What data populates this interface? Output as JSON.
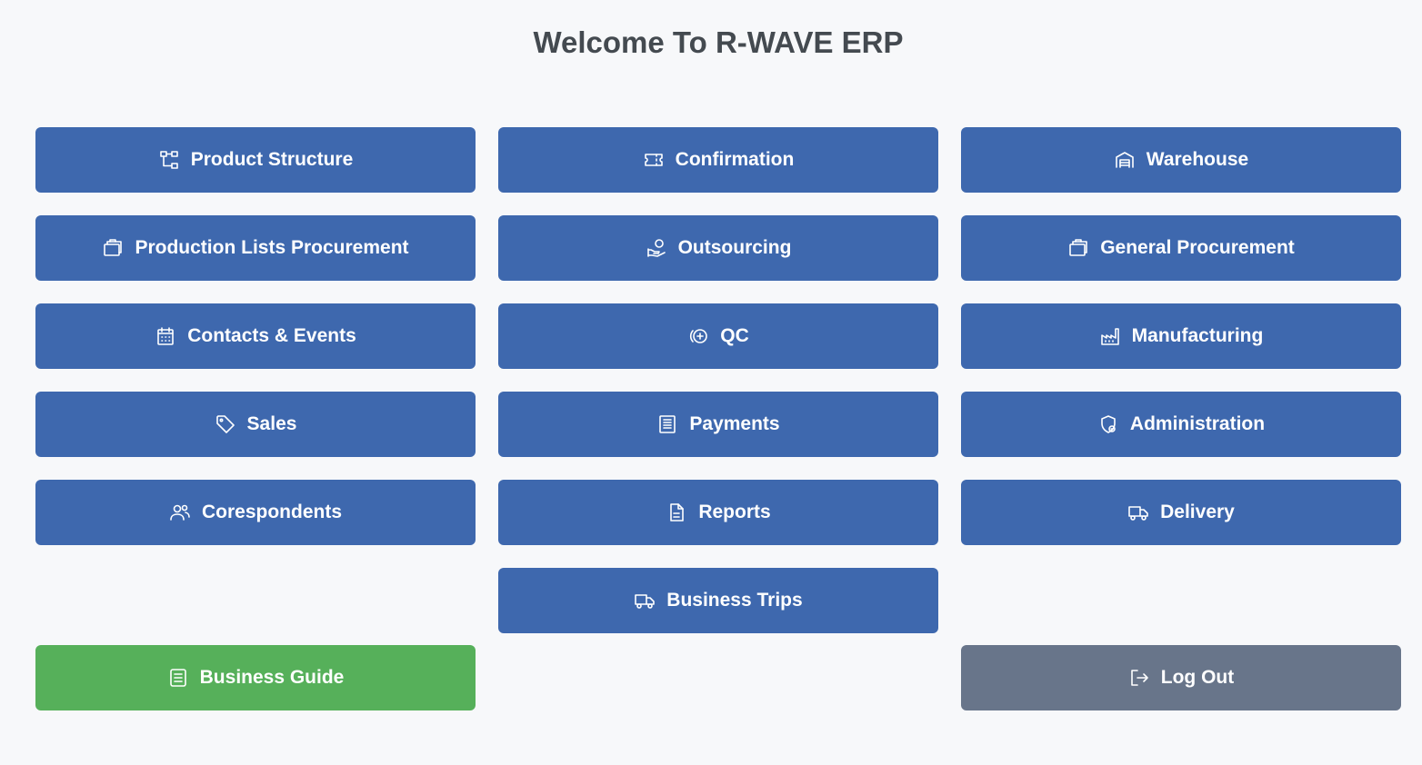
{
  "header": {
    "title": "Welcome To R-WAVE ERP"
  },
  "colors": {
    "primary_button": "#3e68ae",
    "guide_button": "#56b05a",
    "logout_button": "#68758a",
    "background": "#f7f8fa"
  },
  "menu": {
    "product_structure": {
      "label": "Product Structure",
      "icon": "hierarchy-icon"
    },
    "confirmation": {
      "label": "Confirmation",
      "icon": "ticket-icon"
    },
    "warehouse": {
      "label": "Warehouse",
      "icon": "warehouse-icon"
    },
    "production_lists_procurement": {
      "label": "Production Lists Procurement",
      "icon": "stack-icon"
    },
    "outsourcing": {
      "label": "Outsourcing",
      "icon": "hand-coin-icon"
    },
    "general_procurement": {
      "label": "General Procurement",
      "icon": "stack-icon"
    },
    "contacts_events": {
      "label": "Contacts & Events",
      "icon": "calendar-icon"
    },
    "qc": {
      "label": "QC",
      "icon": "circle-plus-icon"
    },
    "manufacturing": {
      "label": "Manufacturing",
      "icon": "factory-icon"
    },
    "sales": {
      "label": "Sales",
      "icon": "tag-icon"
    },
    "payments": {
      "label": "Payments",
      "icon": "receipt-icon"
    },
    "administration": {
      "label": "Administration",
      "icon": "shield-icon"
    },
    "corespondents": {
      "label": "Corespondents",
      "icon": "users-icon"
    },
    "reports": {
      "label": "Reports",
      "icon": "document-icon"
    },
    "delivery": {
      "label": "Delivery",
      "icon": "truck-icon"
    },
    "business_trips": {
      "label": "Business Trips",
      "icon": "truck-icon"
    },
    "business_guide": {
      "label": "Business Guide",
      "icon": "book-icon"
    },
    "log_out": {
      "label": "Log Out",
      "icon": "logout-icon"
    }
  }
}
